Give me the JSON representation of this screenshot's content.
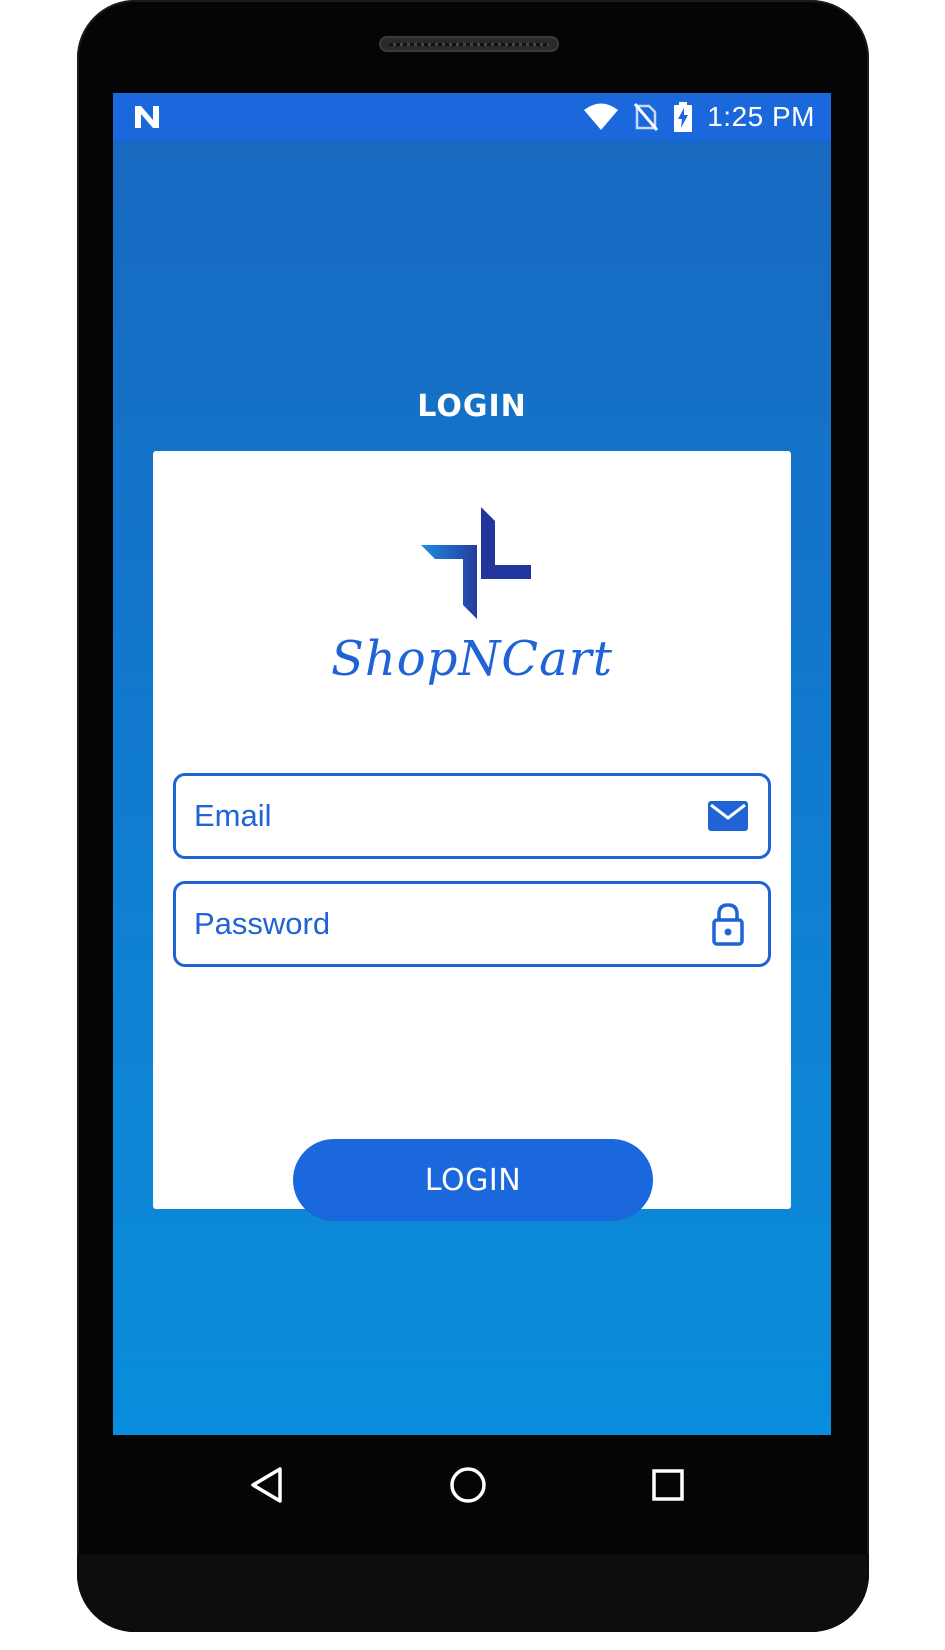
{
  "status_bar": {
    "notification_icon": "n-logo-icon",
    "icons": [
      "wifi-icon",
      "no-sim-icon",
      "battery-charging-icon"
    ],
    "time": "1:25 PM",
    "background_color": "#1b67dc"
  },
  "page": {
    "title": "LOGIN",
    "background_color": "#1868bf"
  },
  "card": {
    "logo_icon": "shopncart-logo-icon",
    "brand_name": "ShopNCart",
    "email_field": {
      "placeholder": "Email",
      "value": "",
      "icon": "mail-icon"
    },
    "password_field": {
      "placeholder": "Password",
      "value": "",
      "icon": "lock-icon"
    },
    "login_button_label": "LOGIN"
  },
  "nav_bar": {
    "items": [
      "back-icon",
      "home-icon",
      "recents-icon"
    ]
  },
  "colors": {
    "accent": "#1f63d6",
    "button": "#1b67dc",
    "card": "#ffffff"
  }
}
